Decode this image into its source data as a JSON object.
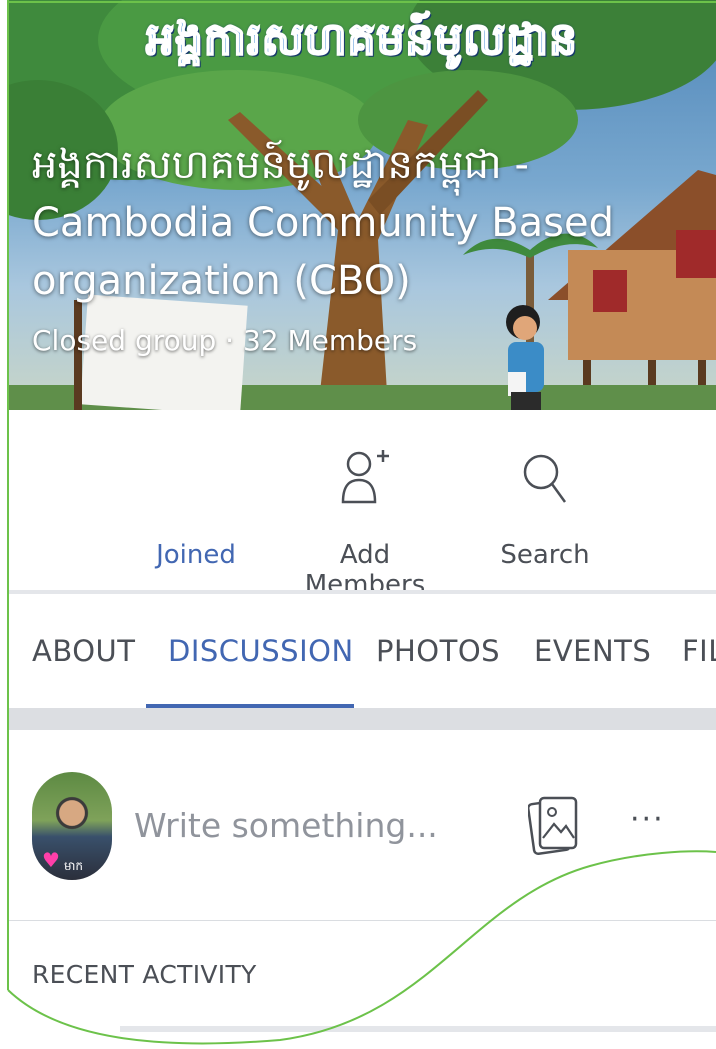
{
  "cover": {
    "banner_text": "អង្គការសហគមន៍មូលដ្ឋាន",
    "title": "អង្គការសហគមន៍មូលដ្ឋានកម្ពុជា - Cambodia Community Based organization (CBO)",
    "meta": "Closed group · 32 Members"
  },
  "actions": {
    "joined": "Joined",
    "add_members": "Add Members",
    "search": "Search"
  },
  "tabs": [
    {
      "label": "ABOUT"
    },
    {
      "label": "DISCUSSION",
      "active": true
    },
    {
      "label": "PHOTOS"
    },
    {
      "label": "EVENTS"
    },
    {
      "label": "FIL"
    }
  ],
  "composer": {
    "placeholder": "Write something...",
    "more": "···",
    "avatar_tag": "មាក"
  },
  "sections": {
    "recent_activity": "RECENT ACTIVITY"
  },
  "colors": {
    "accent": "#4267b2",
    "text": "#4b4f56",
    "muted": "#90949c",
    "frame_green": "#6cc24a",
    "heart": "#ff3fa9"
  },
  "icons": {
    "add_members": "add-person-icon",
    "search": "magnifier-icon",
    "photo": "photo-icon",
    "more": "more-dots-icon",
    "avatar_badge": "heart-icon"
  }
}
